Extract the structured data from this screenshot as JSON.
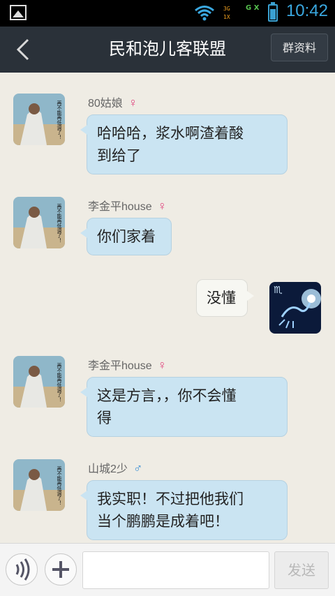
{
  "status_bar": {
    "time": "10:42",
    "network_top": "3G",
    "network_bottom": "1X",
    "gx": "G X"
  },
  "header": {
    "back_icon": "chevron-left-icon",
    "title": "民和泡儿客联盟",
    "group_info_label": "群资料"
  },
  "messages": [
    {
      "side": "left",
      "sender": "80姑娘",
      "gender": "♀",
      "text_lines": [
        "哈哈哈，浆水啊渣着酸",
        "到给了"
      ]
    },
    {
      "side": "left",
      "sender": "李金平house",
      "gender": "♀",
      "text_lines": [
        "你们家着"
      ]
    },
    {
      "side": "right",
      "text_lines": [
        "没懂"
      ]
    },
    {
      "side": "left",
      "sender": "李金平house",
      "gender": "♀",
      "text_lines": [
        "这是方言，，你不会懂",
        "得"
      ]
    },
    {
      "side": "left",
      "sender": "山城2少",
      "gender": "♂",
      "text_lines": [
        "我实职！不过把他我们",
        "当个鹏鹏是成着吧！"
      ]
    }
  ],
  "avatar_caption": "再不能再低调了！",
  "input_bar": {
    "voice_icon": "voice-icon",
    "plus_icon": "plus-icon",
    "text_value": "",
    "send_label": "发送"
  }
}
